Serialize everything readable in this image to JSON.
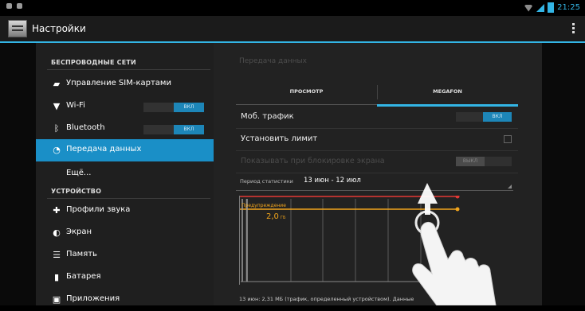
{
  "status_bar": {
    "time": "21:25",
    "icons": [
      "usb-icon",
      "notification-icon",
      "wifi-icon",
      "signal-icon",
      "battery-icon"
    ]
  },
  "action_bar": {
    "title": "Настройки"
  },
  "sidebar": {
    "sections": [
      {
        "header": "БЕСПРОВОДНЫЕ СЕТИ",
        "items": [
          {
            "label": "Управление SIM-картами",
            "icon": "sim-icon"
          },
          {
            "label": "Wi-Fi",
            "icon": "wifi-icon",
            "toggle": "ВКЛ"
          },
          {
            "label": "Bluetooth",
            "icon": "bluetooth-icon",
            "toggle": "ВКЛ"
          },
          {
            "label": "Передача данных",
            "icon": "data-usage-icon",
            "active": true
          },
          {
            "label": "Ещё..."
          }
        ]
      },
      {
        "header": "УСТРОЙСТВО",
        "items": [
          {
            "label": "Профили звука",
            "icon": "sound-icon"
          },
          {
            "label": "Экран",
            "icon": "display-icon"
          },
          {
            "label": "Память",
            "icon": "storage-icon"
          },
          {
            "label": "Батарея",
            "icon": "battery-icon"
          },
          {
            "label": "Приложения",
            "icon": "apps-icon"
          }
        ]
      }
    ]
  },
  "main": {
    "title": "Передача данных",
    "tabs": [
      "ПРОСМОТР",
      "MEGAFON"
    ],
    "selected_tab": "MEGAFON",
    "rows": [
      {
        "label": "Моб. трафик",
        "control": "toggle",
        "value": "ВКЛ"
      },
      {
        "label": "Установить лимит",
        "control": "checkbox"
      },
      {
        "label": "Показывать при блокировке экрана",
        "control": "toggle",
        "value": "ВЫКЛ",
        "disabled": true
      }
    ],
    "period": {
      "label": "Период статистики",
      "value": "13 июн - 12 июл"
    },
    "chart": {
      "warning_label": "Предупреждение",
      "warning_value": "2,0",
      "warning_unit": "ГБ"
    },
    "footer": "13 июн: 2,31 МБ (трафик, определенный устройством). Данные"
  },
  "colors": {
    "accent": "#33b5e5",
    "active_item": "#1a8fc7",
    "limit_line": "#e53935",
    "warning_line": "#f2a51c"
  }
}
